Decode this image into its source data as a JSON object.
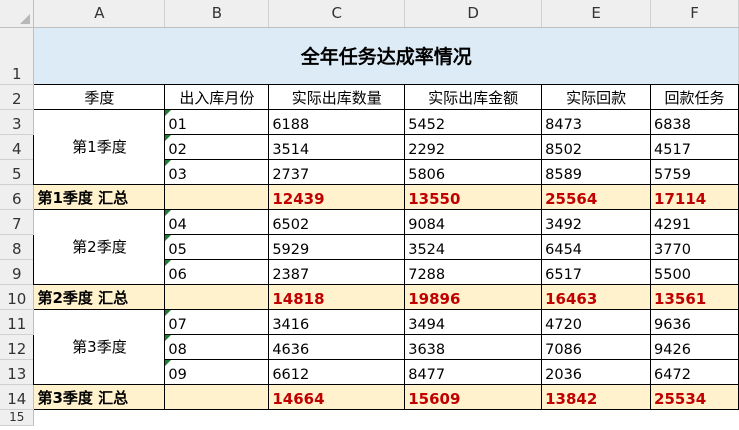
{
  "columns": [
    "A",
    "B",
    "C",
    "D",
    "E",
    "F"
  ],
  "row_numbers": [
    "1",
    "2",
    "3",
    "4",
    "5",
    "6",
    "7",
    "8",
    "9",
    "10",
    "11",
    "12",
    "13",
    "14",
    "15"
  ],
  "title": "全年任务达成率情况",
  "headers": [
    "季度",
    "出入库月份",
    "实际出库数量",
    "实际出库金额",
    "实际回款",
    "回款任务"
  ],
  "groups": [
    {
      "quarter": "第1季度",
      "rows": [
        {
          "month": "01",
          "qty": "6188",
          "amount": "5452",
          "collected": "8473",
          "target": "6838"
        },
        {
          "month": "02",
          "qty": "3514",
          "amount": "2292",
          "collected": "8502",
          "target": "4517"
        },
        {
          "month": "03",
          "qty": "2737",
          "amount": "5806",
          "collected": "8589",
          "target": "5759"
        }
      ],
      "summary": {
        "label": "第1季度 汇总",
        "qty": "12439",
        "amount": "13550",
        "collected": "25564",
        "target": "17114"
      }
    },
    {
      "quarter": "第2季度",
      "rows": [
        {
          "month": "04",
          "qty": "6502",
          "amount": "9084",
          "collected": "3492",
          "target": "4291"
        },
        {
          "month": "05",
          "qty": "5929",
          "amount": "3524",
          "collected": "6454",
          "target": "3770"
        },
        {
          "month": "06",
          "qty": "2387",
          "amount": "7288",
          "collected": "6517",
          "target": "5500"
        }
      ],
      "summary": {
        "label": "第2季度 汇总",
        "qty": "14818",
        "amount": "19896",
        "collected": "16463",
        "target": "13561"
      }
    },
    {
      "quarter": "第3季度",
      "rows": [
        {
          "month": "07",
          "qty": "3416",
          "amount": "3494",
          "collected": "4720",
          "target": "9636"
        },
        {
          "month": "08",
          "qty": "4636",
          "amount": "3638",
          "collected": "7086",
          "target": "9426"
        },
        {
          "month": "09",
          "qty": "6612",
          "amount": "8477",
          "collected": "2036",
          "target": "6472"
        }
      ],
      "summary": {
        "label": "第3季度 汇总",
        "qty": "14664",
        "amount": "15609",
        "collected": "13842",
        "target": "25534"
      }
    }
  ],
  "colors": {
    "title_bg": "#ddebf7",
    "summary_bg": "#fff2cc",
    "summary_text": "#c00000",
    "header_bg": "#efefef"
  }
}
